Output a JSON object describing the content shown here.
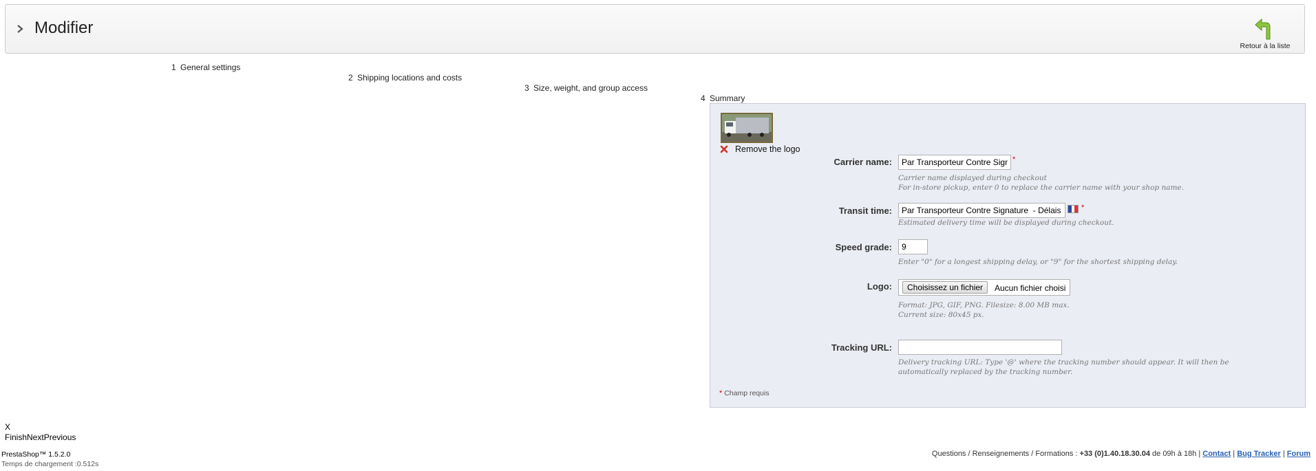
{
  "header": {
    "title": "Modifier",
    "back_label": "Retour à la liste"
  },
  "steps": [
    {
      "num": "1",
      "label": "General settings"
    },
    {
      "num": "2",
      "label": "Shipping locations and costs"
    },
    {
      "num": "3",
      "label": "Size, weight, and group access"
    },
    {
      "num": "4",
      "label": "Summary"
    }
  ],
  "summary": {
    "remove_logo": "Remove the logo",
    "carrier_name": {
      "label": "Carrier name:",
      "value": "Par Transporteur Contre Signature",
      "hint1": "Carrier name displayed during checkout",
      "hint2": "For in-store pickup, enter 0 to replace the carrier name with your shop name."
    },
    "transit_time": {
      "label": "Transit time:",
      "value": "Par Transporteur Contre Signature  - Délais",
      "hint": "Estimated delivery time will be displayed during checkout."
    },
    "speed_grade": {
      "label": "Speed grade:",
      "value": "9",
      "hint": "Enter \"0\" for a longest shipping delay, or \"9\" for the shortest shipping delay."
    },
    "logo": {
      "label": "Logo:",
      "button": "Choisissez un fichier",
      "status": "Aucun fichier choisi",
      "hint1": "Format: JPG, GIF, PNG. Filesize: 8.00 MB max.",
      "hint2": "Current size: 80x45 px."
    },
    "tracking_url": {
      "label": "Tracking URL:",
      "value": "",
      "hint1": "Delivery tracking URL: Type '@' where the tracking number should appear. It will then be",
      "hint2": "automatically replaced by the tracking number."
    },
    "required_star": "*",
    "required_note": "Champ requis"
  },
  "wizard": {
    "close": "X",
    "finish": "Finish",
    "next": "Next",
    "previous": "Previous"
  },
  "footer": {
    "version": "PrestaShop™ 1.5.2.0",
    "load_time": "Temps de chargement :0.512s",
    "info_prefix": "Questions / Renseignements / Formations : ",
    "phone": "+33 (0)1.40.18.30.04",
    "hours": " de 09h à 18h",
    "sep": " | ",
    "contact": "Contact",
    "bug_tracker": "Bug Tracker",
    "forum": "Forum"
  },
  "colors": {
    "panel_bg": "#ebedf4",
    "link": "#2a60b4",
    "required": "#cc0000",
    "back_arrow": "#8cc63f"
  }
}
